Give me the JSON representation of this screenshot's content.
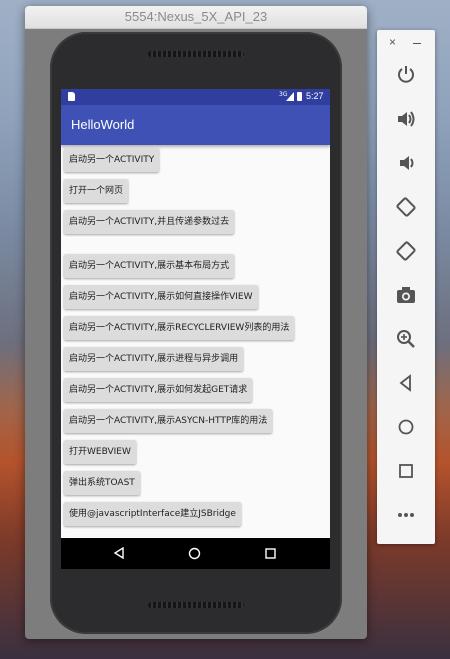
{
  "window": {
    "title": "5554:Nexus_5X_API_23"
  },
  "statusbar": {
    "network": "3G",
    "time": "5:27"
  },
  "app": {
    "title": "HelloWorld"
  },
  "buttons": [
    "启动另一个ACTIVITY",
    "打开一个网页",
    "启动另一个ACTIVITY,并且传递参数过去",
    "启动另一个ACTIVITY,展示基本布局方式",
    "启动另一个ACTIVITY,展示如何直接操作VIEW",
    "启动另一个ACTIVITY,展示RECYCLERVIEW列表的用法",
    "启动另一个ACTIVITY,展示进程与异步调用",
    "启动另一个ACTIVITY,展示如何发起GET请求",
    "启动另一个ACTIVITY,展示ASYCN-HTTP库的用法",
    "打开WEBVIEW",
    "弹出系统TOAST",
    "使用@javascriptInterface建立JSBridge"
  ],
  "toolbar": {
    "close": "×",
    "items": [
      "power-icon",
      "volume-up-icon",
      "volume-down-icon",
      "rotate-left-icon",
      "rotate-right-icon",
      "camera-icon",
      "zoom-icon",
      "back-icon",
      "home-icon",
      "overview-icon",
      "more-icon"
    ]
  },
  "colors": {
    "appbar": "#3f51b5",
    "statusbar": "#303f9f",
    "button": "#dcdcdc",
    "screen": "#fafafa"
  }
}
